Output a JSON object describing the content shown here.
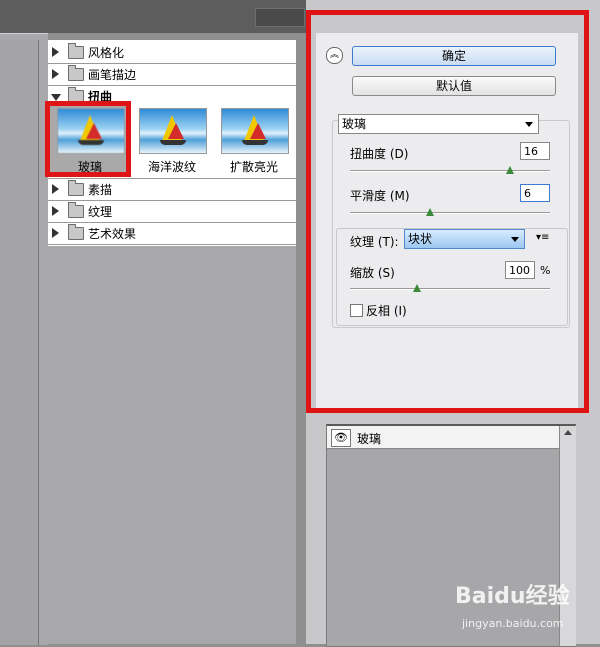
{
  "filter_tree": {
    "categories": [
      {
        "label": "风格化",
        "expanded": false
      },
      {
        "label": "画笔描边",
        "expanded": false
      },
      {
        "label": "扭曲",
        "expanded": true
      },
      {
        "label": "素描",
        "expanded": false
      },
      {
        "label": "纹理",
        "expanded": false
      },
      {
        "label": "艺术效果",
        "expanded": false
      }
    ],
    "distort_filters": [
      {
        "label": "玻璃",
        "selected": true
      },
      {
        "label": "海洋波纹",
        "selected": false
      },
      {
        "label": "扩散亮光",
        "selected": false
      }
    ]
  },
  "settings": {
    "ok_label": "确定",
    "default_label": "默认值",
    "filter_select": "玻璃",
    "distortion": {
      "label": "扭曲度 (D)",
      "value": "16",
      "level": 16,
      "max": 20
    },
    "smoothness": {
      "label": "平滑度 (M)",
      "value": "6",
      "level": 6,
      "max": 15
    },
    "texture": {
      "label": "纹理 (T):",
      "value": "块状"
    },
    "scaling": {
      "label": "缩放 (S)",
      "value": "100",
      "unit": "%",
      "level": 100,
      "min": 50,
      "max": 200
    },
    "invert": {
      "label": "反相 (I)",
      "checked": false
    }
  },
  "layers": {
    "items": [
      {
        "label": "玻璃",
        "visible": true
      }
    ]
  },
  "watermark": {
    "brand": "Baidu经验",
    "url": "jingyan.baidu.com"
  },
  "colors": {
    "highlight_box": "#e01414",
    "primary_button": "#3d7bd0",
    "slider_knob": "#3a8a3a"
  }
}
